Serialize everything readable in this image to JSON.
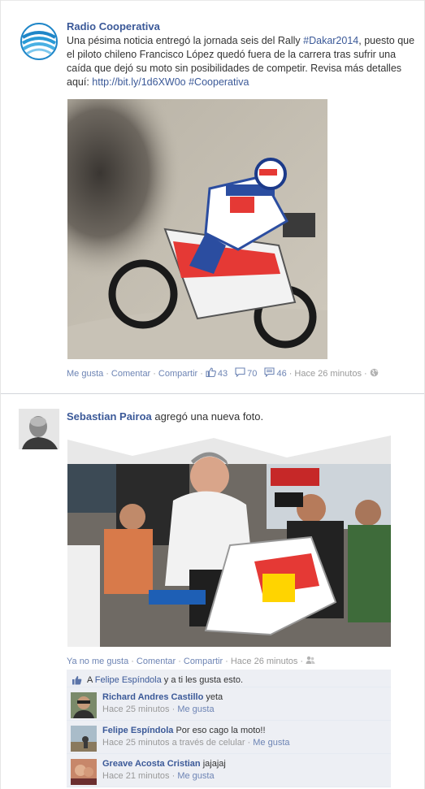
{
  "posts": [
    {
      "author": "Radio Cooperativa",
      "message_text": "Una pésima noticia entregó la jornada seis del Rally ",
      "hashtag1": "#Dakar2014",
      "message_text2": ", puesto que el piloto chileno Francisco López quedó fuera de la carrera tras sufrir una caída que dejó su moto sin posibilidades de competir. Revisa más detalles aquí: ",
      "url": "http://bit.ly/1d6XW0o",
      "hashtag2": "#Cooperativa",
      "actions": {
        "like": "Me gusta",
        "comment": "Comentar",
        "share": "Compartir",
        "likes_count": "43",
        "comments_count": "70",
        "shares_count": "46",
        "time": "Hace 26 minutos"
      },
      "icons": [
        "cooperativa-logo",
        "thumbs-up-icon",
        "comment-icon",
        "share-icon",
        "globe-icon"
      ]
    },
    {
      "author": "Sebastian Pairoa",
      "headline_rest": " agregó una nueva foto.",
      "actions": {
        "unlike": "Ya no me gusta",
        "comment": "Comentar",
        "share": "Compartir",
        "time": "Hace 26 minutos"
      },
      "likes_line": {
        "prefix": "A ",
        "name": "Felipe Espíndola",
        "suffix": " y a ti les gusta esto."
      },
      "comments": [
        {
          "name": "Richard Andres Castillo",
          "text": "yeta",
          "time": "Hace 25 minutos",
          "via": "",
          "like": "Me gusta"
        },
        {
          "name": "Felipe Espíndola",
          "text": "Por eso cago la moto!!",
          "time": "Hace 25 minutos",
          "via": " a través de celular",
          "like": "Me gusta"
        },
        {
          "name": "Greave Acosta Cristian",
          "text": "jajajaj",
          "time": "Hace 21 minutos",
          "via": "",
          "like": "Me gusta"
        }
      ],
      "icons": [
        "friends-icon",
        "thumbs-up-icon"
      ]
    }
  ],
  "colors": {
    "link": "#3b5998",
    "action": "#6d84b4",
    "meta": "#999999",
    "ufi_bg": "#edeff4"
  }
}
